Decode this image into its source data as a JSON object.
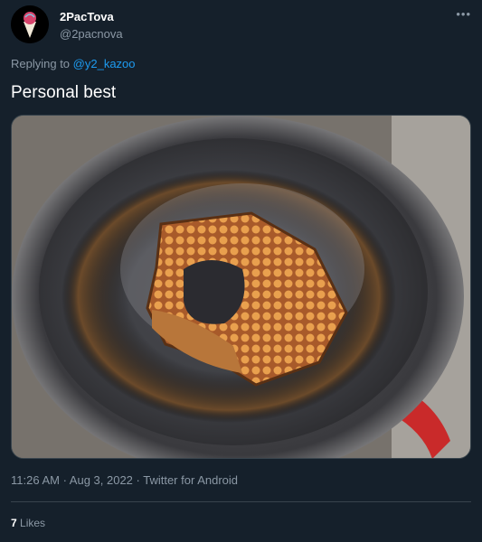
{
  "tweet": {
    "display_name": "2PacTova",
    "handle": "@2pacnova",
    "more_label": "•••",
    "replying_prefix": "Replying to ",
    "replying_to": "@y2_kazoo",
    "text": "Personal best",
    "timestamp": "11:26 AM · Aug 3, 2022 · Twitter for Android",
    "likes_count": "7",
    "likes_label": "Likes"
  },
  "colors": {
    "background": "#15202b",
    "secondary_text": "#8b98a5",
    "link": "#1d9bf0",
    "divider": "#38444d"
  },
  "photo": {
    "alt": ""
  }
}
